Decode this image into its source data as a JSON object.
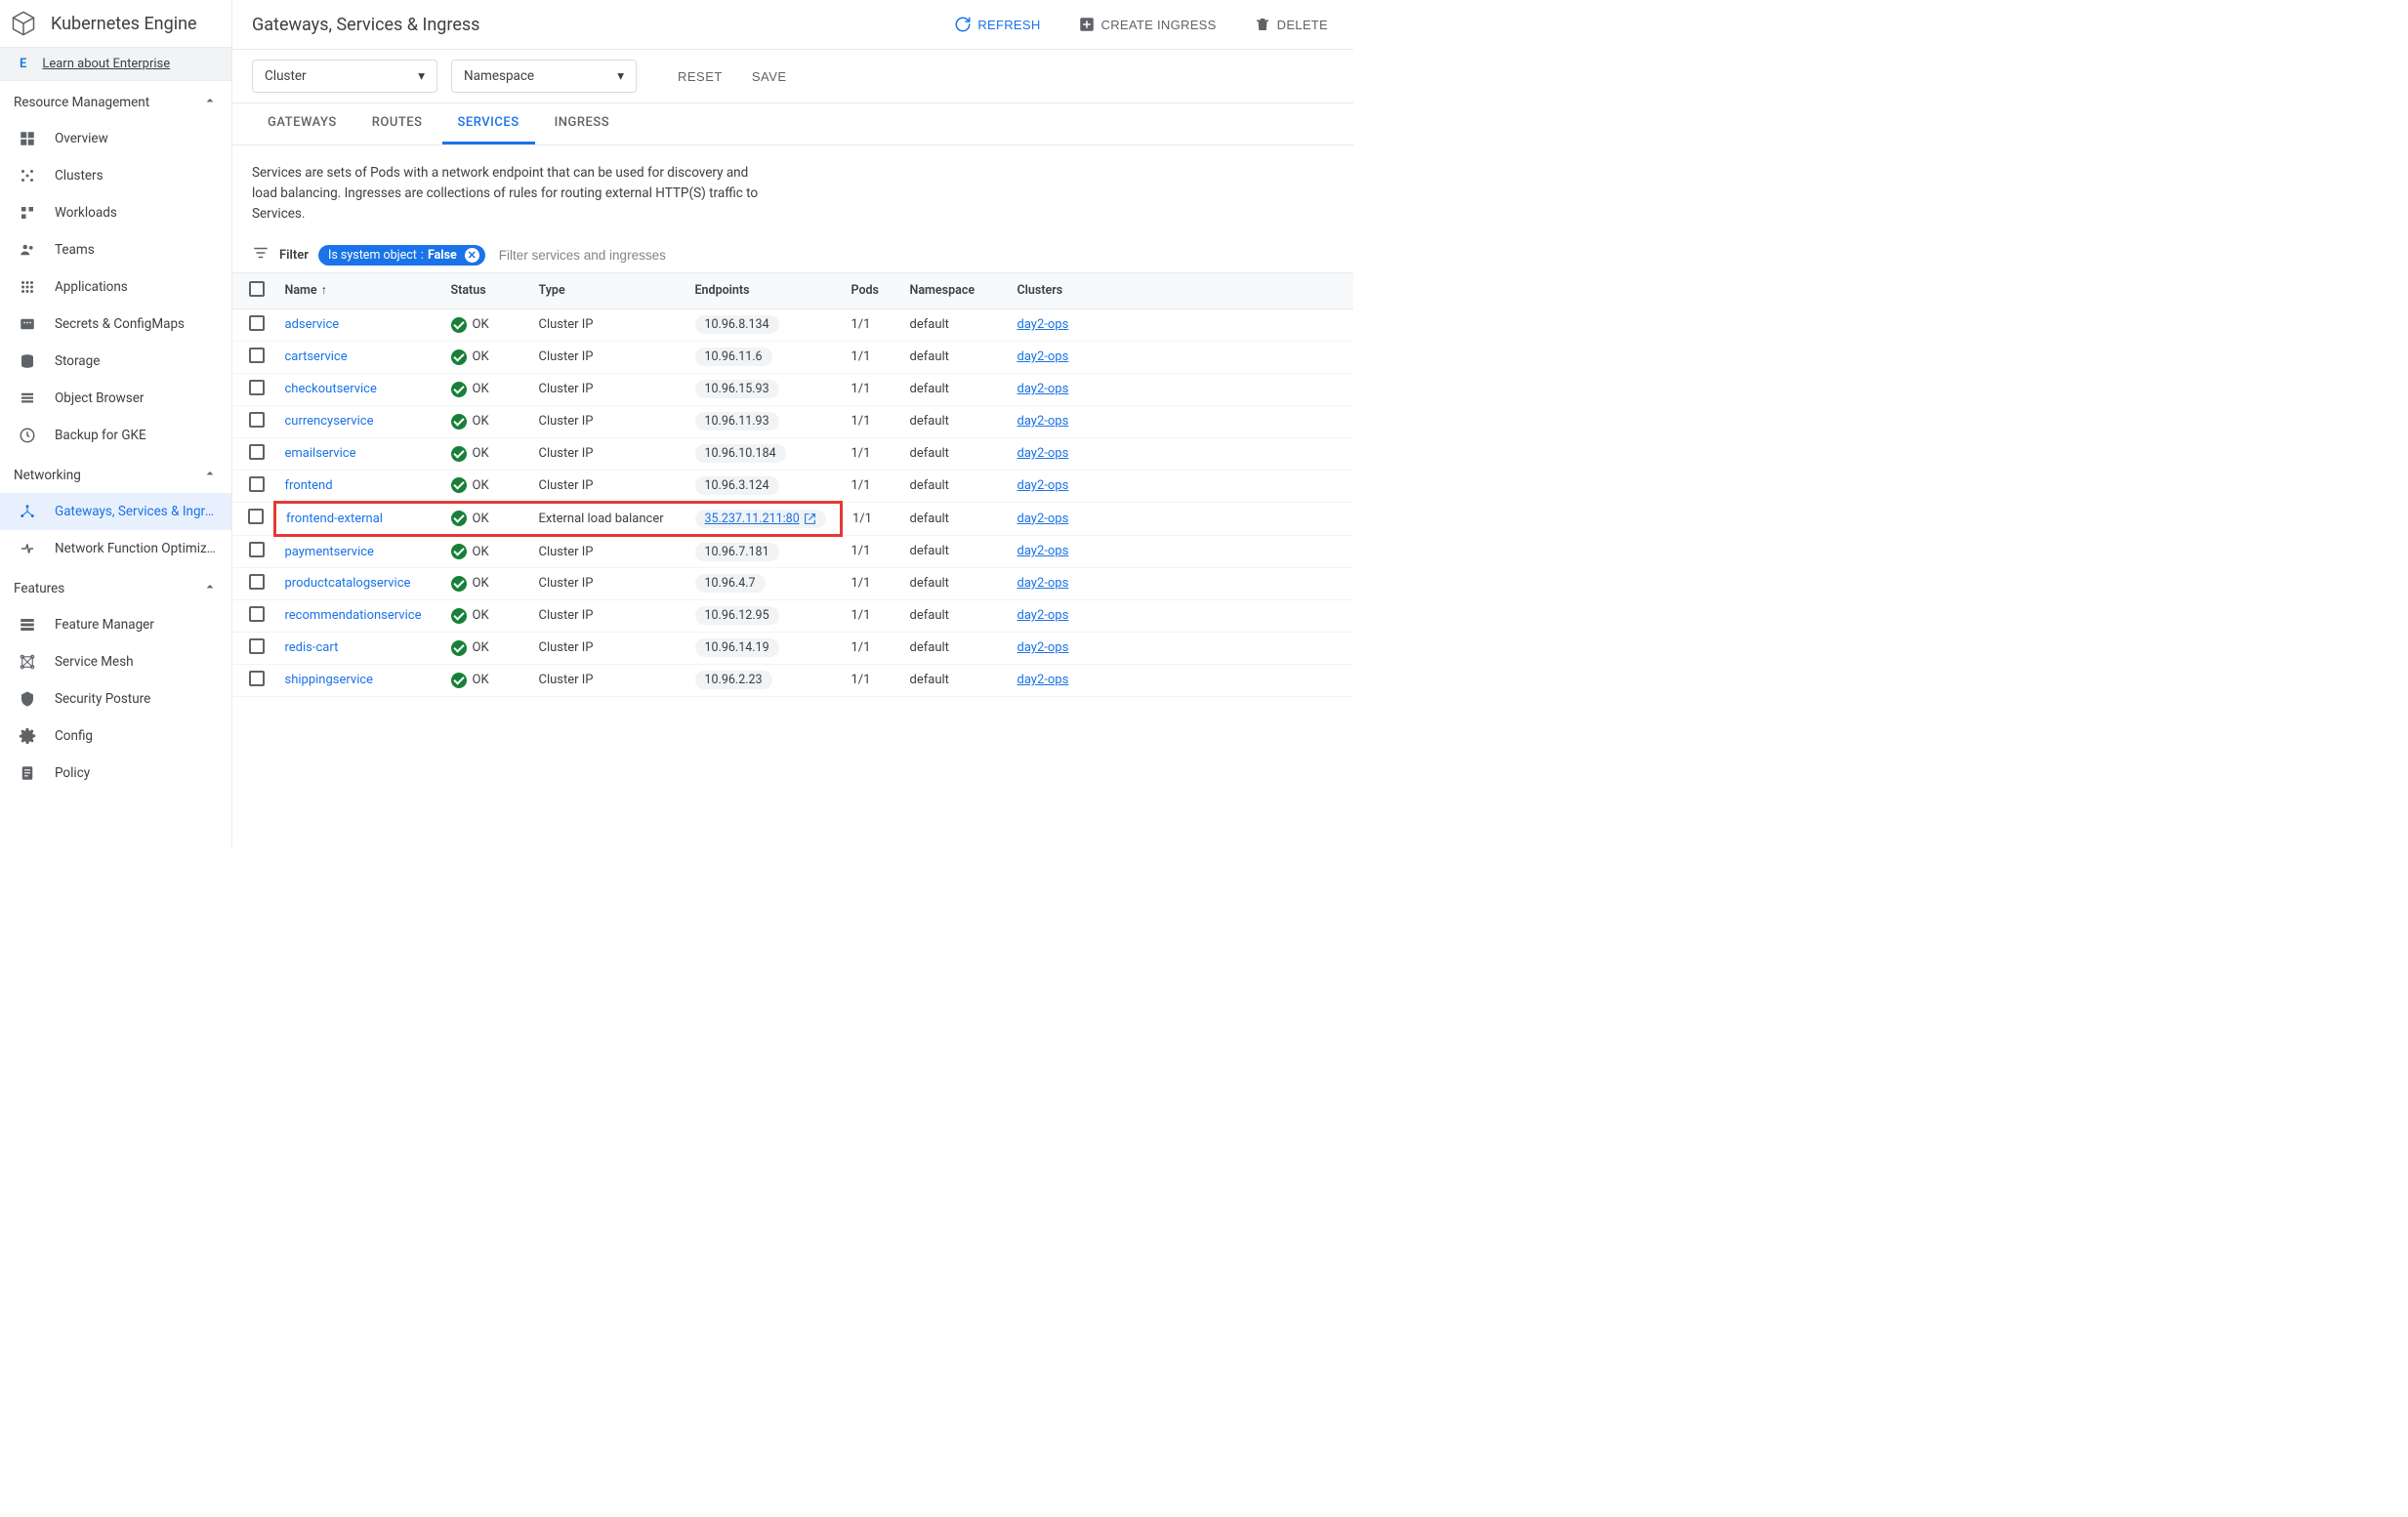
{
  "sidebar": {
    "product_title": "Kubernetes Engine",
    "enterprise_badge": "E",
    "enterprise_link": "Learn about Enterprise",
    "sections": [
      {
        "title": "Resource Management",
        "expanded": true,
        "items": [
          {
            "label": "Overview",
            "icon": "overview"
          },
          {
            "label": "Clusters",
            "icon": "clusters"
          },
          {
            "label": "Workloads",
            "icon": "workloads"
          },
          {
            "label": "Teams",
            "icon": "teams"
          },
          {
            "label": "Applications",
            "icon": "apps"
          },
          {
            "label": "Secrets & ConfigMaps",
            "icon": "secrets"
          },
          {
            "label": "Storage",
            "icon": "storage"
          },
          {
            "label": "Object Browser",
            "icon": "browser"
          },
          {
            "label": "Backup for GKE",
            "icon": "backup"
          }
        ]
      },
      {
        "title": "Networking",
        "expanded": true,
        "items": [
          {
            "label": "Gateways, Services & Ingre…",
            "icon": "gateways",
            "active": true
          },
          {
            "label": "Network Function Optimiz…",
            "icon": "nfo"
          }
        ]
      },
      {
        "title": "Features",
        "expanded": true,
        "items": [
          {
            "label": "Feature Manager",
            "icon": "fm"
          },
          {
            "label": "Service Mesh",
            "icon": "mesh"
          },
          {
            "label": "Security Posture",
            "icon": "security"
          },
          {
            "label": "Config",
            "icon": "config"
          },
          {
            "label": "Policy",
            "icon": "policy"
          }
        ]
      }
    ]
  },
  "header": {
    "page_title": "Gateways, Services & Ingress",
    "refresh": "REFRESH",
    "create_ingress": "CREATE INGRESS",
    "delete": "DELETE"
  },
  "toolbar": {
    "cluster_label": "Cluster",
    "namespace_label": "Namespace",
    "reset": "RESET",
    "save": "SAVE"
  },
  "tabs": [
    {
      "label": "GATEWAYS",
      "active": false
    },
    {
      "label": "ROUTES",
      "active": false
    },
    {
      "label": "SERVICES",
      "active": true
    },
    {
      "label": "INGRESS",
      "active": false
    }
  ],
  "description": "Services are sets of Pods with a network endpoint that can be used for discovery and load balancing. Ingresses are collections of rules for routing external HTTP(S) traffic to Services.",
  "filter": {
    "label": "Filter",
    "chip_key": "Is system object",
    "chip_value": "False",
    "placeholder": "Filter services and ingresses"
  },
  "table": {
    "columns": [
      "Name",
      "Status",
      "Type",
      "Endpoints",
      "Pods",
      "Namespace",
      "Clusters"
    ],
    "sort_col": "Name",
    "sort_dir": "asc",
    "rows": [
      {
        "name": "adservice",
        "status": "OK",
        "type": "Cluster IP",
        "endpoint": "10.96.8.134",
        "pods": "1/1",
        "namespace": "default",
        "cluster": "day2-ops",
        "external": false
      },
      {
        "name": "cartservice",
        "status": "OK",
        "type": "Cluster IP",
        "endpoint": "10.96.11.6",
        "pods": "1/1",
        "namespace": "default",
        "cluster": "day2-ops",
        "external": false
      },
      {
        "name": "checkoutservice",
        "status": "OK",
        "type": "Cluster IP",
        "endpoint": "10.96.15.93",
        "pods": "1/1",
        "namespace": "default",
        "cluster": "day2-ops",
        "external": false
      },
      {
        "name": "currencyservice",
        "status": "OK",
        "type": "Cluster IP",
        "endpoint": "10.96.11.93",
        "pods": "1/1",
        "namespace": "default",
        "cluster": "day2-ops",
        "external": false
      },
      {
        "name": "emailservice",
        "status": "OK",
        "type": "Cluster IP",
        "endpoint": "10.96.10.184",
        "pods": "1/1",
        "namespace": "default",
        "cluster": "day2-ops",
        "external": false
      },
      {
        "name": "frontend",
        "status": "OK",
        "type": "Cluster IP",
        "endpoint": "10.96.3.124",
        "pods": "1/1",
        "namespace": "default",
        "cluster": "day2-ops",
        "external": false
      },
      {
        "name": "frontend-external",
        "status": "OK",
        "type": "External load balancer",
        "endpoint": "35.237.11.211:80",
        "pods": "1/1",
        "namespace": "default",
        "cluster": "day2-ops",
        "external": true,
        "highlight": true
      },
      {
        "name": "paymentservice",
        "status": "OK",
        "type": "Cluster IP",
        "endpoint": "10.96.7.181",
        "pods": "1/1",
        "namespace": "default",
        "cluster": "day2-ops",
        "external": false
      },
      {
        "name": "productcatalogservice",
        "status": "OK",
        "type": "Cluster IP",
        "endpoint": "10.96.4.7",
        "pods": "1/1",
        "namespace": "default",
        "cluster": "day2-ops",
        "external": false
      },
      {
        "name": "recommendationservice",
        "status": "OK",
        "type": "Cluster IP",
        "endpoint": "10.96.12.95",
        "pods": "1/1",
        "namespace": "default",
        "cluster": "day2-ops",
        "external": false
      },
      {
        "name": "redis-cart",
        "status": "OK",
        "type": "Cluster IP",
        "endpoint": "10.96.14.19",
        "pods": "1/1",
        "namespace": "default",
        "cluster": "day2-ops",
        "external": false
      },
      {
        "name": "shippingservice",
        "status": "OK",
        "type": "Cluster IP",
        "endpoint": "10.96.2.23",
        "pods": "1/1",
        "namespace": "default",
        "cluster": "day2-ops",
        "external": false
      }
    ]
  }
}
